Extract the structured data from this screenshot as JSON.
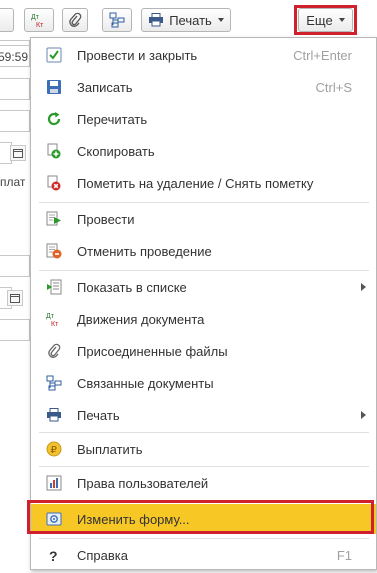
{
  "toolbar": {
    "dt_kt_icon": "dt-kt-icon",
    "print_label": "Печать",
    "more_label": "Еще"
  },
  "background": {
    "time_fragment": "59:59",
    "payment_fragment": "плат"
  },
  "menu": {
    "items": [
      {
        "label": "Провести и закрыть",
        "shortcut": "Ctrl+Enter",
        "icon": "post-and-close-icon"
      },
      {
        "label": "Записать",
        "shortcut": "Ctrl+S",
        "icon": "save-icon"
      },
      {
        "label": "Перечитать",
        "shortcut": "",
        "icon": "reload-icon"
      },
      {
        "label": "Скопировать",
        "shortcut": "",
        "icon": "copy-icon"
      },
      {
        "label": "Пометить на удаление / Снять пометку",
        "shortcut": "",
        "icon": "delete-mark-icon"
      },
      {
        "label": "Провести",
        "shortcut": "",
        "icon": "post-icon"
      },
      {
        "label": "Отменить проведение",
        "shortcut": "",
        "icon": "unpost-icon"
      },
      {
        "label": "Показать в списке",
        "shortcut": "",
        "icon": "show-in-list-icon"
      },
      {
        "label": "Движения документа",
        "shortcut": "",
        "icon": "dt-kt-icon"
      },
      {
        "label": "Присоединенные файлы",
        "shortcut": "",
        "icon": "paperclip-icon"
      },
      {
        "label": "Связанные документы",
        "shortcut": "",
        "icon": "related-docs-icon"
      },
      {
        "label": "Печать",
        "shortcut": "",
        "icon": "printer-icon"
      },
      {
        "label": "Выплатить",
        "shortcut": "",
        "icon": "ruble-coin-icon"
      },
      {
        "label": "Права пользователей",
        "shortcut": "",
        "icon": "user-rights-icon"
      },
      {
        "label": "Изменить форму...",
        "shortcut": "",
        "icon": "change-form-icon"
      },
      {
        "label": "Справка",
        "shortcut": "F1",
        "icon": "help-icon"
      }
    ]
  },
  "colors": {
    "highlight": "#f7c726",
    "annotation_border": "#d0202e",
    "shortcut_text": "#a0a0a0"
  }
}
